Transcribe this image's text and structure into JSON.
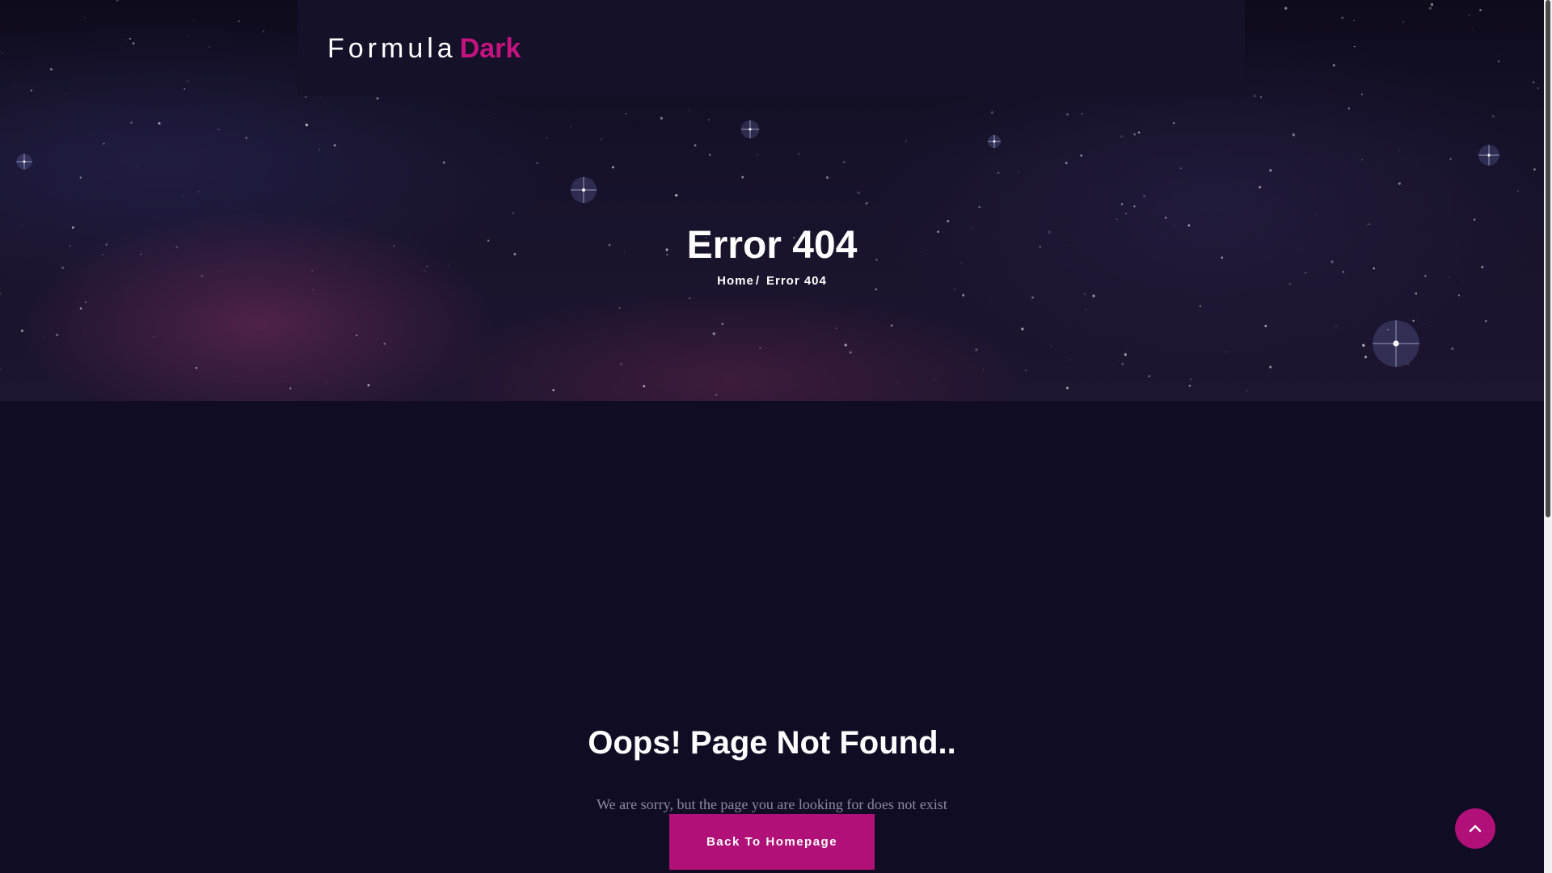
{
  "header": {
    "logo_part1": "Formula",
    "logo_part2": "Dark"
  },
  "hero": {
    "title": "Error 404",
    "breadcrumb": {
      "home": "Home",
      "separator": "/",
      "current": "Error 404"
    }
  },
  "main": {
    "title": "Oops! Page Not Found..",
    "message": "We are sorry, but the page you are looking for does not exist",
    "button_label": "Back To Homepage"
  },
  "scroll_top": {
    "icon": "chevron-up-icon"
  },
  "colors": {
    "accent": "#b01077",
    "logo_accent": "#c4137f",
    "background": "#100c24",
    "header_bar": "#151129",
    "muted_text": "#8e8a9e"
  }
}
